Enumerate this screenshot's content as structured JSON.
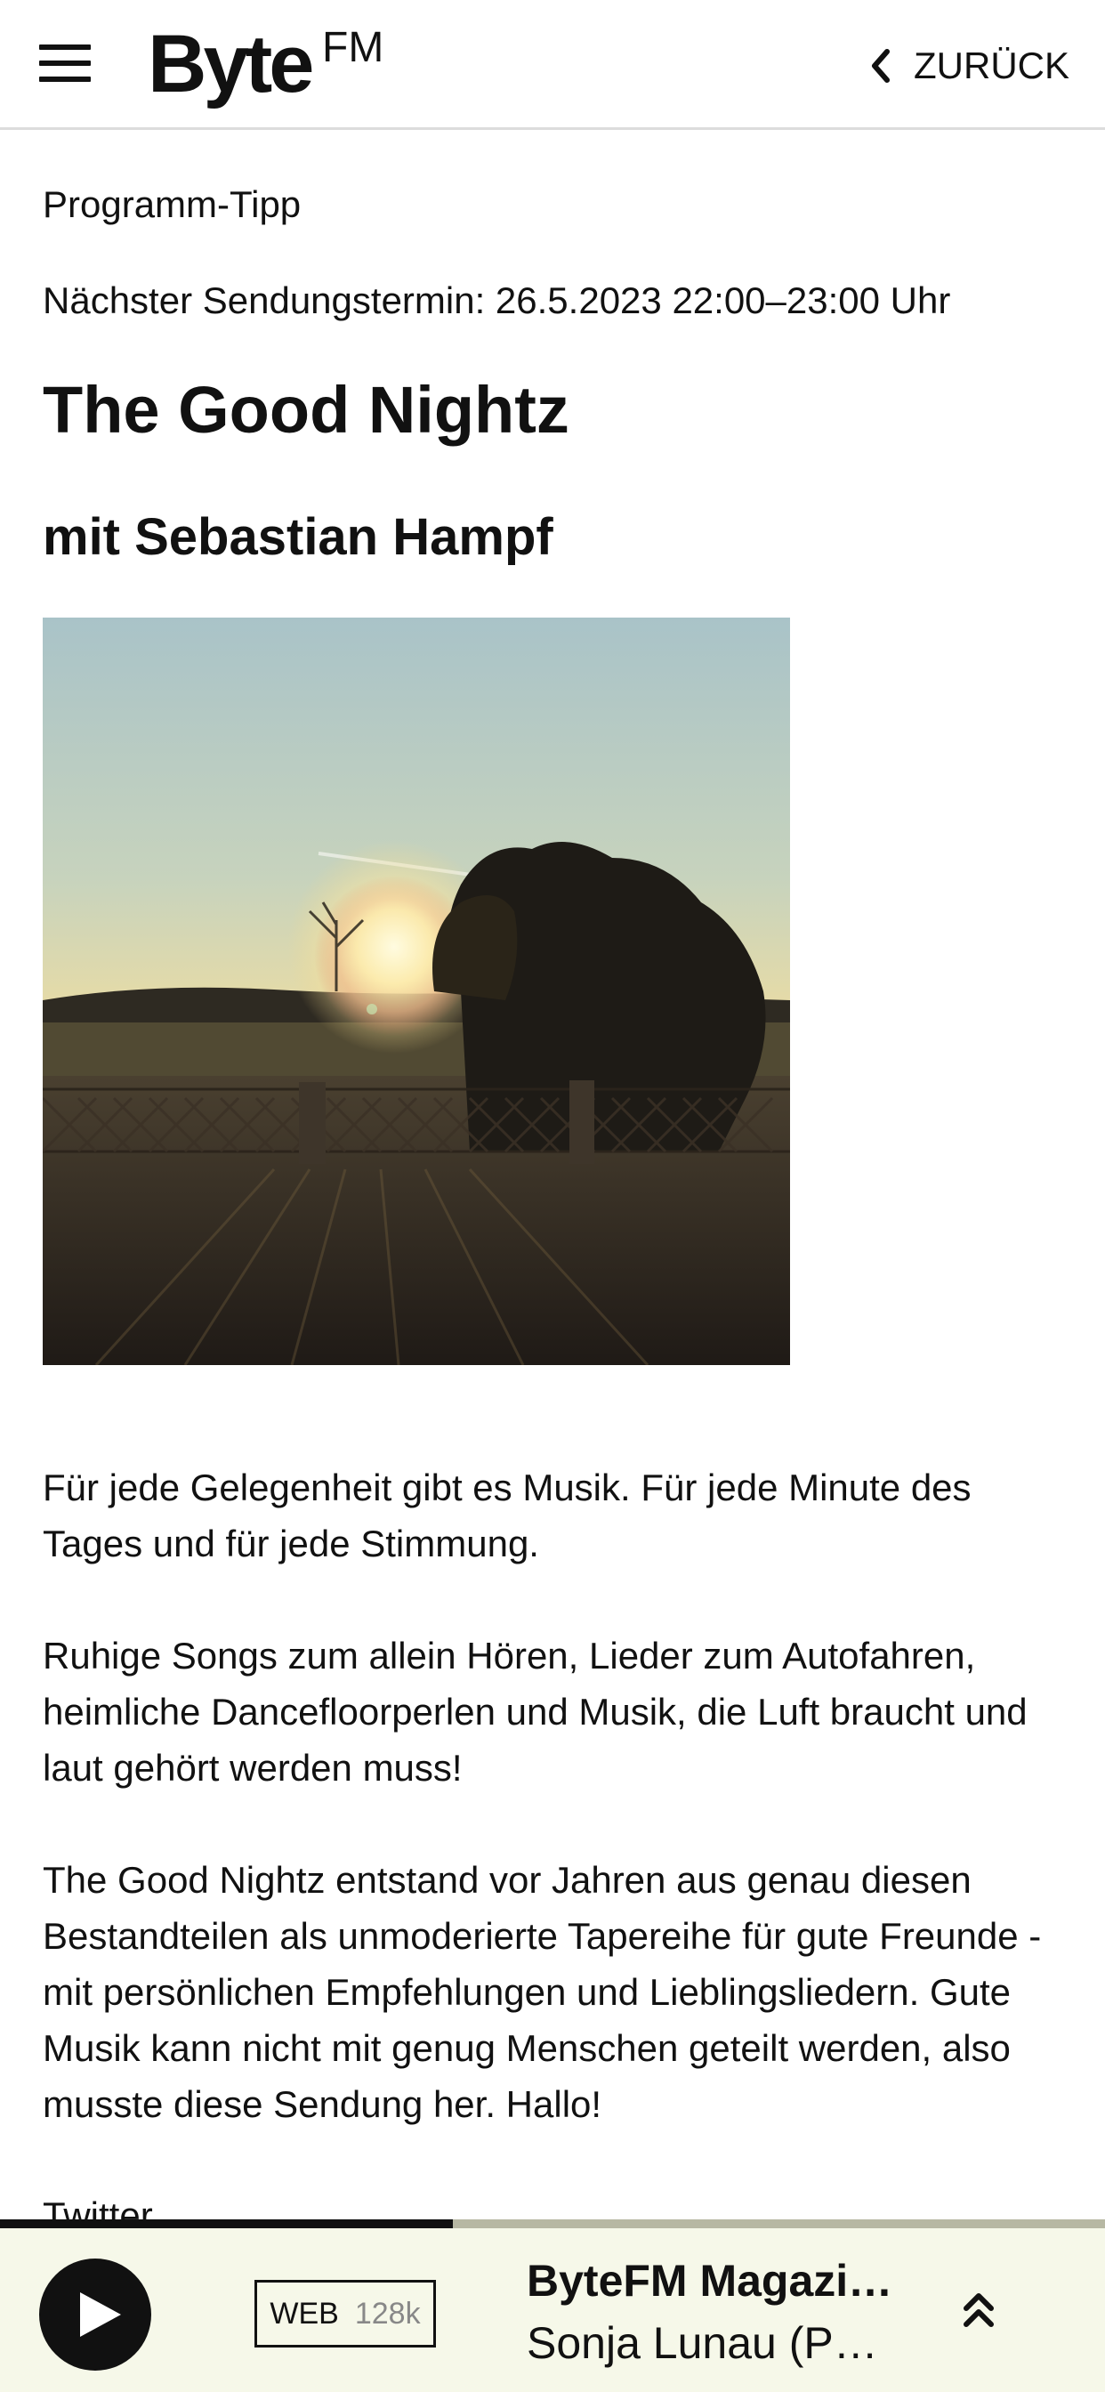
{
  "header": {
    "logo_main": "Byte",
    "logo_sup": "FM",
    "back_label": "ZURÜCK"
  },
  "article": {
    "kicker": "Programm-Tipp",
    "schedule": "Nächster Sendungstermin: 26.5.2023 22:00–23:00 Uhr",
    "title": "The Good Nightz",
    "subtitle": "mit Sebastian Hampf",
    "paragraphs": [
      "Für jede Gelegenheit gibt es Musik. Für jede Minute des Tages und für jede Stimmung.",
      "Ruhige Songs zum allein Hören, Lieder zum Autofahren, heimliche Dancefloorperlen und Musik, die Luft braucht und laut gehört werden muss!",
      "The Good Nightz entstand vor Jahren aus genau diesen Bestandteilen als unmoderierte Tapereihe für gute Freunde - mit persönlichen Empfehlungen und Lieblingsliedern. Gute Musik kann nicht mit genug Menschen geteilt werden, also musste diese Sendung her. Hallo!"
    ],
    "cut_off_link": "Twitter"
  },
  "player": {
    "progress_fraction": 0.41,
    "stream": "WEB",
    "bitrate": "128k",
    "show": "ByteFM Magazi…",
    "host": "Sonja Lunau (Po…"
  },
  "icons": {
    "menu": "hamburger-menu-icon",
    "back": "chevron-left-icon",
    "play": "play-icon",
    "expand": "double-chevron-up-icon"
  },
  "colors": {
    "player_bg": "#f6f8e9",
    "progress_track": "#b7b8a3",
    "progress_fill": "#111111"
  }
}
